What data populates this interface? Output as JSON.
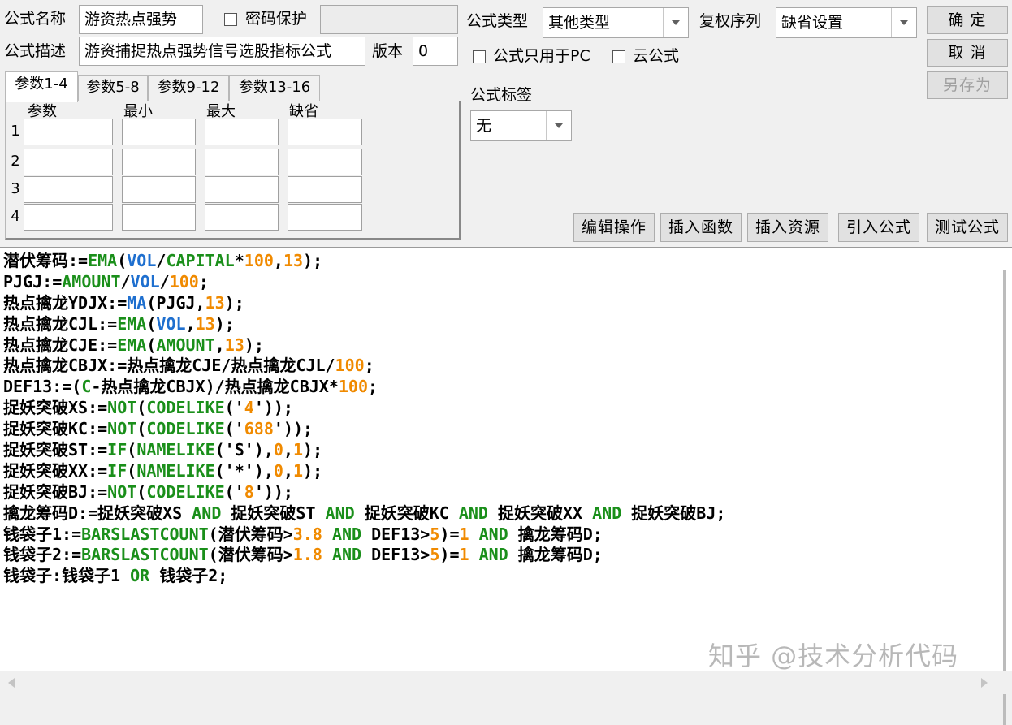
{
  "header": {
    "name_label": "公式名称",
    "name_value": "游资热点强势",
    "password_label": "密码保护",
    "password_checked": false,
    "password_value": "",
    "desc_label": "公式描述",
    "desc_value": "游资捕捉热点强势信号选股指标公式",
    "version_label": "版本",
    "version_value": "0",
    "type_label": "公式类型",
    "type_value": "其他类型",
    "adjust_label": "复权序列",
    "adjust_value": "缺省设置",
    "pc_only_label": "公式只用于PC",
    "pc_only_checked": false,
    "cloud_label": "云公式",
    "cloud_checked": false,
    "tag_label": "公式标签",
    "tag_value": "无"
  },
  "buttons": {
    "ok": "确 定",
    "cancel": "取 消",
    "save_as": "另存为",
    "edit_ops": "编辑操作",
    "insert_func": "插入函数",
    "insert_res": "插入资源",
    "import_formula": "引入公式",
    "test_formula": "测试公式"
  },
  "tabs": [
    "参数1-4",
    "参数5-8",
    "参数9-12",
    "参数13-16"
  ],
  "params": {
    "headers": [
      "参数",
      "最小",
      "最大",
      "缺省"
    ],
    "rows": [
      {
        "num": "1",
        "values": [
          "",
          "",
          "",
          ""
        ]
      },
      {
        "num": "2",
        "values": [
          "",
          "",
          "",
          ""
        ]
      },
      {
        "num": "3",
        "values": [
          "",
          "",
          "",
          ""
        ]
      },
      {
        "num": "4",
        "values": [
          "",
          "",
          "",
          ""
        ]
      }
    ]
  },
  "syntax_colors": {
    "text": "#000000",
    "func": "#1a8f1a",
    "var": "#1e6fcf",
    "num": "#f08a00"
  },
  "code_lines": [
    [
      [
        "t",
        "潜伏筹码:="
      ],
      [
        "f",
        "EMA"
      ],
      [
        "t",
        "("
      ],
      [
        "v",
        "VOL"
      ],
      [
        "t",
        "/"
      ],
      [
        "f",
        "CAPITAL"
      ],
      [
        "t",
        "*"
      ],
      [
        "n",
        "100"
      ],
      [
        "t",
        ","
      ],
      [
        "n",
        "13"
      ],
      [
        "t",
        ");"
      ]
    ],
    [
      [
        "t",
        "PJGJ:="
      ],
      [
        "f",
        "AMOUNT"
      ],
      [
        "t",
        "/"
      ],
      [
        "v",
        "VOL"
      ],
      [
        "t",
        "/"
      ],
      [
        "n",
        "100"
      ],
      [
        "t",
        ";"
      ]
    ],
    [
      [
        "t",
        "热点擒龙YDJX:="
      ],
      [
        "v",
        "MA"
      ],
      [
        "t",
        "(PJGJ,"
      ],
      [
        "n",
        "13"
      ],
      [
        "t",
        ");"
      ]
    ],
    [
      [
        "t",
        "热点擒龙CJL:="
      ],
      [
        "f",
        "EMA"
      ],
      [
        "t",
        "("
      ],
      [
        "v",
        "VOL"
      ],
      [
        "t",
        ","
      ],
      [
        "n",
        "13"
      ],
      [
        "t",
        ");"
      ]
    ],
    [
      [
        "t",
        "热点擒龙CJE:="
      ],
      [
        "f",
        "EMA"
      ],
      [
        "t",
        "("
      ],
      [
        "f",
        "AMOUNT"
      ],
      [
        "t",
        ","
      ],
      [
        "n",
        "13"
      ],
      [
        "t",
        ");"
      ]
    ],
    [
      [
        "t",
        "热点擒龙CBJX:=热点擒龙CJE/热点擒龙CJL/"
      ],
      [
        "n",
        "100"
      ],
      [
        "t",
        ";"
      ]
    ],
    [
      [
        "t",
        "DEF13:=("
      ],
      [
        "f",
        "C"
      ],
      [
        "t",
        "-热点擒龙CBJX)/热点擒龙CBJX*"
      ],
      [
        "n",
        "100"
      ],
      [
        "t",
        ";"
      ]
    ],
    [
      [
        "t",
        "捉妖突破XS:="
      ],
      [
        "f",
        "NOT"
      ],
      [
        "t",
        "("
      ],
      [
        "f",
        "CODELIKE"
      ],
      [
        "t",
        "('"
      ],
      [
        "n",
        "4"
      ],
      [
        "t",
        "'));"
      ]
    ],
    [
      [
        "t",
        "捉妖突破KC:="
      ],
      [
        "f",
        "NOT"
      ],
      [
        "t",
        "("
      ],
      [
        "f",
        "CODELIKE"
      ],
      [
        "t",
        "('"
      ],
      [
        "n",
        "688"
      ],
      [
        "t",
        "'));"
      ]
    ],
    [
      [
        "t",
        "捉妖突破ST:="
      ],
      [
        "f",
        "IF"
      ],
      [
        "t",
        "("
      ],
      [
        "f",
        "NAMELIKE"
      ],
      [
        "t",
        "('S'),"
      ],
      [
        "n",
        "0"
      ],
      [
        "t",
        ","
      ],
      [
        "n",
        "1"
      ],
      [
        "t",
        ");"
      ]
    ],
    [
      [
        "t",
        "捉妖突破XX:="
      ],
      [
        "f",
        "IF"
      ],
      [
        "t",
        "("
      ],
      [
        "f",
        "NAMELIKE"
      ],
      [
        "t",
        "('*'),"
      ],
      [
        "n",
        "0"
      ],
      [
        "t",
        ","
      ],
      [
        "n",
        "1"
      ],
      [
        "t",
        ");"
      ]
    ],
    [
      [
        "t",
        "捉妖突破BJ:="
      ],
      [
        "f",
        "NOT"
      ],
      [
        "t",
        "("
      ],
      [
        "f",
        "CODELIKE"
      ],
      [
        "t",
        "('"
      ],
      [
        "n",
        "8"
      ],
      [
        "t",
        "'));"
      ]
    ],
    [
      [
        "t",
        "擒龙筹码D:=捉妖突破XS "
      ],
      [
        "f",
        "AND"
      ],
      [
        "t",
        " 捉妖突破ST "
      ],
      [
        "f",
        "AND"
      ],
      [
        "t",
        " 捉妖突破KC "
      ],
      [
        "f",
        "AND"
      ],
      [
        "t",
        " 捉妖突破XX "
      ],
      [
        "f",
        "AND"
      ],
      [
        "t",
        " 捉妖突破BJ;"
      ]
    ],
    [
      [
        "t",
        "钱袋子1:="
      ],
      [
        "f",
        "BARSLASTCOUNT"
      ],
      [
        "t",
        "(潜伏筹码>"
      ],
      [
        "n",
        "3.8"
      ],
      [
        "t",
        " "
      ],
      [
        "f",
        "AND"
      ],
      [
        "t",
        " DEF13>"
      ],
      [
        "n",
        "5"
      ],
      [
        "t",
        ")="
      ],
      [
        "n",
        "1"
      ],
      [
        "t",
        " "
      ],
      [
        "f",
        "AND"
      ],
      [
        "t",
        " 擒龙筹码D;"
      ]
    ],
    [
      [
        "t",
        "钱袋子2:="
      ],
      [
        "f",
        "BARSLASTCOUNT"
      ],
      [
        "t",
        "(潜伏筹码>"
      ],
      [
        "n",
        "1.8"
      ],
      [
        "t",
        " "
      ],
      [
        "f",
        "AND"
      ],
      [
        "t",
        " DEF13>"
      ],
      [
        "n",
        "5"
      ],
      [
        "t",
        ")="
      ],
      [
        "n",
        "1"
      ],
      [
        "t",
        " "
      ],
      [
        "f",
        "AND"
      ],
      [
        "t",
        " 擒龙筹码D;"
      ]
    ],
    [
      [
        "t",
        "钱袋子:钱袋子1 "
      ],
      [
        "f",
        "OR"
      ],
      [
        "t",
        " 钱袋子2;"
      ]
    ]
  ],
  "watermark": "知乎 @技术分析代码"
}
